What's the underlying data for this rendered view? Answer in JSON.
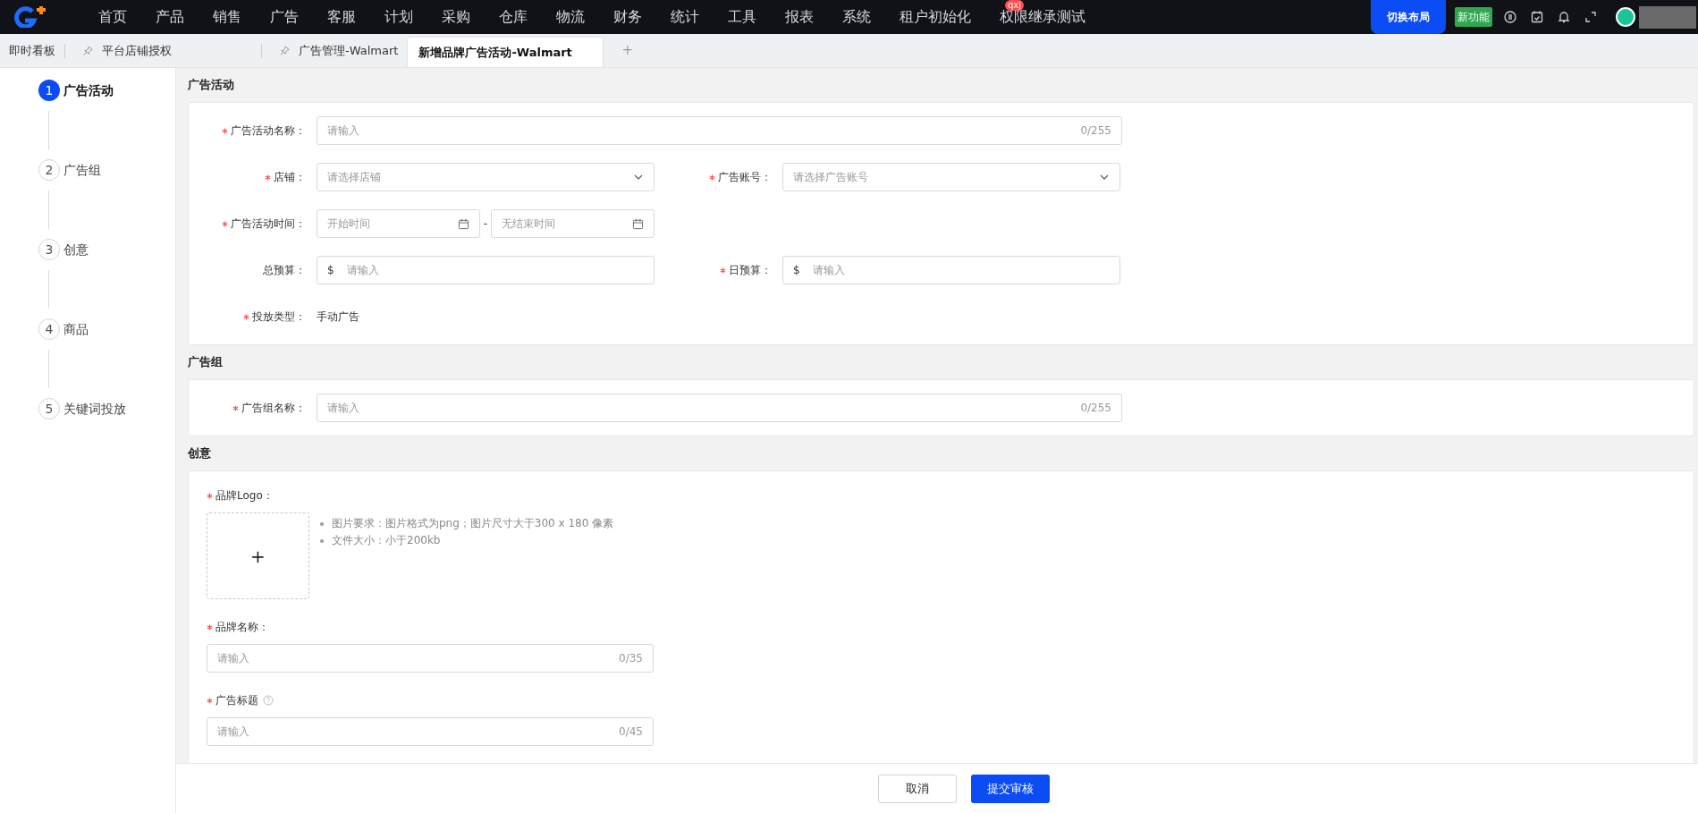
{
  "nav": {
    "items": [
      {
        "label": "首页"
      },
      {
        "label": "产品"
      },
      {
        "label": "销售"
      },
      {
        "label": "广告"
      },
      {
        "label": "客服"
      },
      {
        "label": "计划"
      },
      {
        "label": "采购"
      },
      {
        "label": "仓库"
      },
      {
        "label": "物流"
      },
      {
        "label": "财务"
      },
      {
        "label": "统计"
      },
      {
        "label": "工具"
      },
      {
        "label": "报表"
      },
      {
        "label": "系统"
      },
      {
        "label": "租户初始化"
      },
      {
        "label": "权限继承测试",
        "badge": "qxj"
      }
    ],
    "layout_button": "切换布局",
    "new_badge": "新功能"
  },
  "tabs": [
    {
      "label": "即时看板",
      "pinned": false,
      "selected": false
    },
    {
      "label": "平台店铺授权",
      "pinned": true,
      "selected": false
    },
    {
      "label": "广告管理-Walmart",
      "pinned": true,
      "selected": false
    },
    {
      "label": "新增品牌广告活动-Walmart",
      "pinned": false,
      "selected": true
    }
  ],
  "add_tab": "+",
  "steps": [
    {
      "number": "1",
      "label": "广告活动",
      "selected": true
    },
    {
      "number": "2",
      "label": "广告组",
      "selected": false
    },
    {
      "number": "3",
      "label": "创意",
      "selected": false
    },
    {
      "number": "4",
      "label": "商品",
      "selected": false
    },
    {
      "number": "5",
      "label": "关键词投放",
      "selected": false
    }
  ],
  "sections": [
    {
      "title": "广告活动",
      "kind": "inline",
      "rows": [
        [
          {
            "kind": "text",
            "label": "广告活动名称：",
            "required": true,
            "placeholder": "请输入",
            "counter": "0/255",
            "wide": true
          }
        ],
        [
          {
            "kind": "select",
            "label": "店铺：",
            "required": true,
            "placeholder": "请选择店铺"
          },
          {
            "kind": "select",
            "label": "广告账号：",
            "required": true,
            "placeholder": "请选择广告账号"
          }
        ],
        [
          {
            "kind": "daterange",
            "label": "广告活动时间：",
            "required": true,
            "start_placeholder": "开始时间",
            "separator": "-",
            "end_placeholder": "无结束时间"
          }
        ],
        [
          {
            "kind": "money",
            "label": "总预算：",
            "required": false,
            "prefix": "$",
            "placeholder": "请输入"
          },
          {
            "kind": "money",
            "label": "日预算：",
            "required": true,
            "prefix": "$",
            "placeholder": "请输入"
          }
        ],
        [
          {
            "kind": "static",
            "label": "投放类型：",
            "required": true,
            "value": "手动广告"
          }
        ]
      ]
    },
    {
      "title": "广告组",
      "kind": "inline",
      "rows": [
        [
          {
            "kind": "text",
            "label": "广告组名称：",
            "required": true,
            "placeholder": "请输入",
            "counter": "0/255",
            "wide": true
          }
        ]
      ]
    },
    {
      "title": "创意",
      "kind": "stacked",
      "rows": [
        [
          {
            "kind": "upload",
            "label": "品牌Logo：",
            "required": true,
            "button": "+",
            "hints": [
              "图片要求：图片格式为png；图片尺寸大于300 x 180 像素",
              "文件大小：小于200kb"
            ]
          }
        ],
        [
          {
            "kind": "text",
            "label": "品牌名称：",
            "required": true,
            "placeholder": "请输入",
            "counter": "0/35",
            "help": false,
            "wide": false
          }
        ],
        [
          {
            "kind": "text",
            "label": "广告标题",
            "required": true,
            "placeholder": "请输入",
            "counter": "0/45",
            "help": true,
            "wide": false
          }
        ]
      ]
    }
  ],
  "footer": {
    "buttons": [
      {
        "label": "取消",
        "kind": "default"
      },
      {
        "label": "提交审核",
        "kind": "primary"
      }
    ]
  }
}
